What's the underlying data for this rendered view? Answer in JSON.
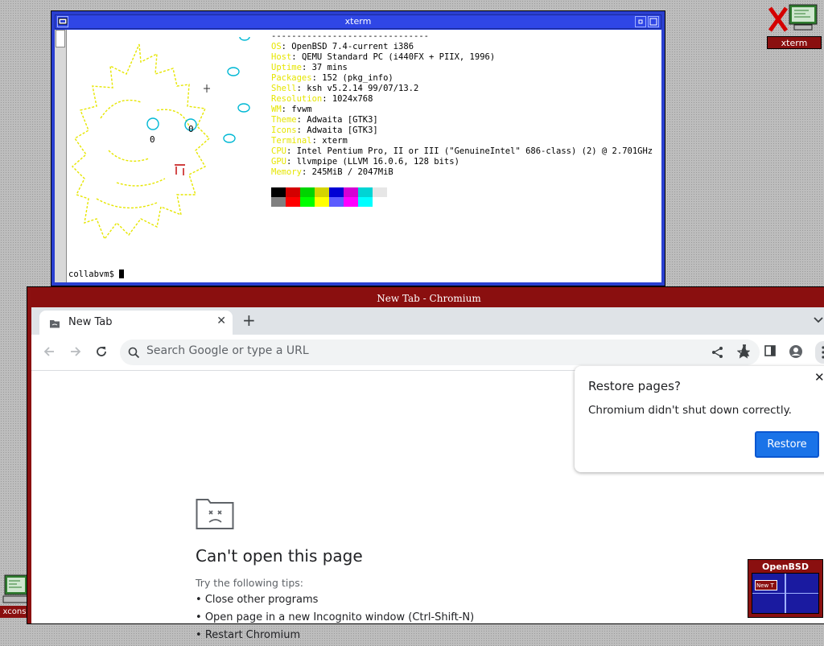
{
  "xterm": {
    "title": "xterm",
    "separator": "-------------------------------",
    "info": [
      {
        "key": "OS",
        "value": ": OpenBSD 7.4-current i386"
      },
      {
        "key": "Host",
        "value": ": QEMU Standard PC (i440FX + PIIX, 1996)"
      },
      {
        "key": "Uptime",
        "value": ": 37 mins"
      },
      {
        "key": "Packages",
        "value": ": 152 (pkg_info)"
      },
      {
        "key": "Shell",
        "value": ": ksh v5.2.14 99/07/13.2"
      },
      {
        "key": "Resolution",
        "value": ": 1024x768"
      },
      {
        "key": "WM",
        "value": ": fvwm"
      },
      {
        "key": "Theme",
        "value": ": Adwaita [GTK3]"
      },
      {
        "key": "Icons",
        "value": ": Adwaita [GTK3]"
      },
      {
        "key": "Terminal",
        "value": ": xterm"
      },
      {
        "key": "CPU",
        "value": ": Intel Pentium Pro, II or III (\"GenuineIntel\" 686-class) (2) @ 2.701GHz"
      },
      {
        "key": "GPU",
        "value": ": llvmpipe (LLVM 16.0.6, 128 bits)"
      },
      {
        "key": "Memory",
        "value": ": 245MiB / 2047MiB"
      }
    ],
    "palette_top": [
      "#000000",
      "#d40000",
      "#00d400",
      "#d4d400",
      "#0000d4",
      "#d400d4",
      "#00d4d4",
      "#e6e6e6"
    ],
    "palette_bottom": [
      "#808080",
      "#ff0000",
      "#00ff00",
      "#ffff00",
      "#5c5cff",
      "#ff00ff",
      "#00ffff",
      "#ffffff"
    ],
    "logo_eyes": [
      "0",
      "0"
    ],
    "prompt": "collabvm$ "
  },
  "chromium": {
    "window_title": "New Tab - Chromium",
    "tab_label": "New Tab",
    "omnibox_placeholder": "Search Google or type a URL",
    "error_title": "Can't open this page",
    "tips_heading": "Try the following tips:",
    "tips": [
      "Close other programs",
      "Open page in a new Incognito window (Ctrl-Shift-N)",
      "Restart Chromium"
    ],
    "accent": "#1a73e8"
  },
  "restore_dialog": {
    "title": "Restore pages?",
    "message": "Chromium didn't shut down correctly.",
    "button_label": "Restore"
  },
  "desktop": {
    "xterm_icon_label": "xterm",
    "xcons_icon_label": "xcons",
    "pager_label": "OpenBSD",
    "pager_mini_label": "New T"
  },
  "colors": {
    "xterm_frame": "#2a3fd0",
    "chromium_frame": "#8a0f0f",
    "logo_yellow": "#e6e600",
    "logo_cyan": "#00b8d4"
  }
}
